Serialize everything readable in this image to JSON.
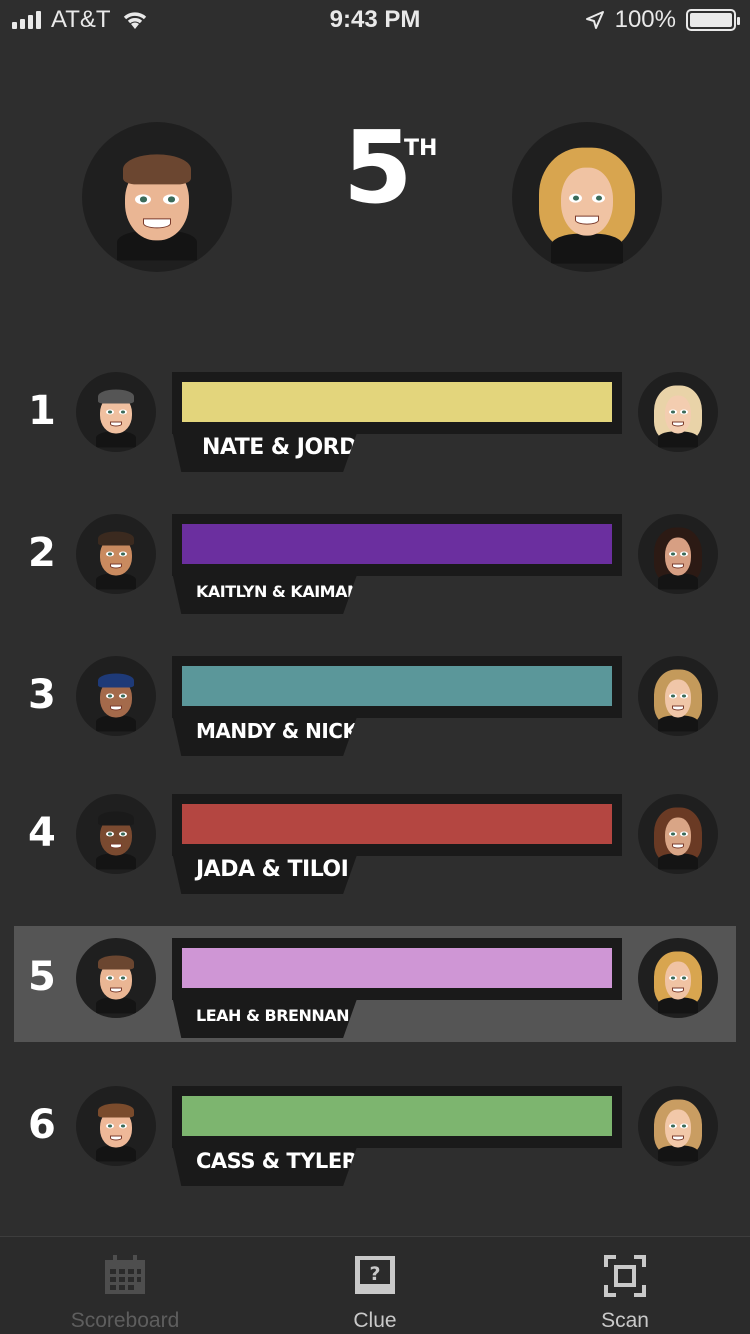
{
  "status_bar": {
    "carrier": "AT&T",
    "time": "9:43 PM",
    "battery": "100%"
  },
  "header": {
    "place_number": "5",
    "place_suffix": "TH"
  },
  "rows": [
    {
      "rank": "1",
      "team": "NATE & JORD",
      "color": "#e3d57c"
    },
    {
      "rank": "2",
      "team": "KAITLYN & KAIMANA",
      "color": "#6b2f9f"
    },
    {
      "rank": "3",
      "team": "MANDY & NICK",
      "color": "#5b979a"
    },
    {
      "rank": "4",
      "team": "JADA & TILOI",
      "color": "#b44641"
    },
    {
      "rank": "5",
      "team": "LEAH & BRENNAN",
      "color": "#cf96d5"
    },
    {
      "rank": "6",
      "team": "CASS & TYLER",
      "color": "#7db56f"
    }
  ],
  "tabbar": {
    "tabs": [
      {
        "label": "Scoreboard",
        "icon": "calendar-grid-icon",
        "state": "inactive"
      },
      {
        "label": "Clue",
        "icon": "question-card-icon",
        "state": "active"
      },
      {
        "label": "Scan",
        "icon": "scan-frame-icon",
        "state": "active"
      }
    ]
  }
}
